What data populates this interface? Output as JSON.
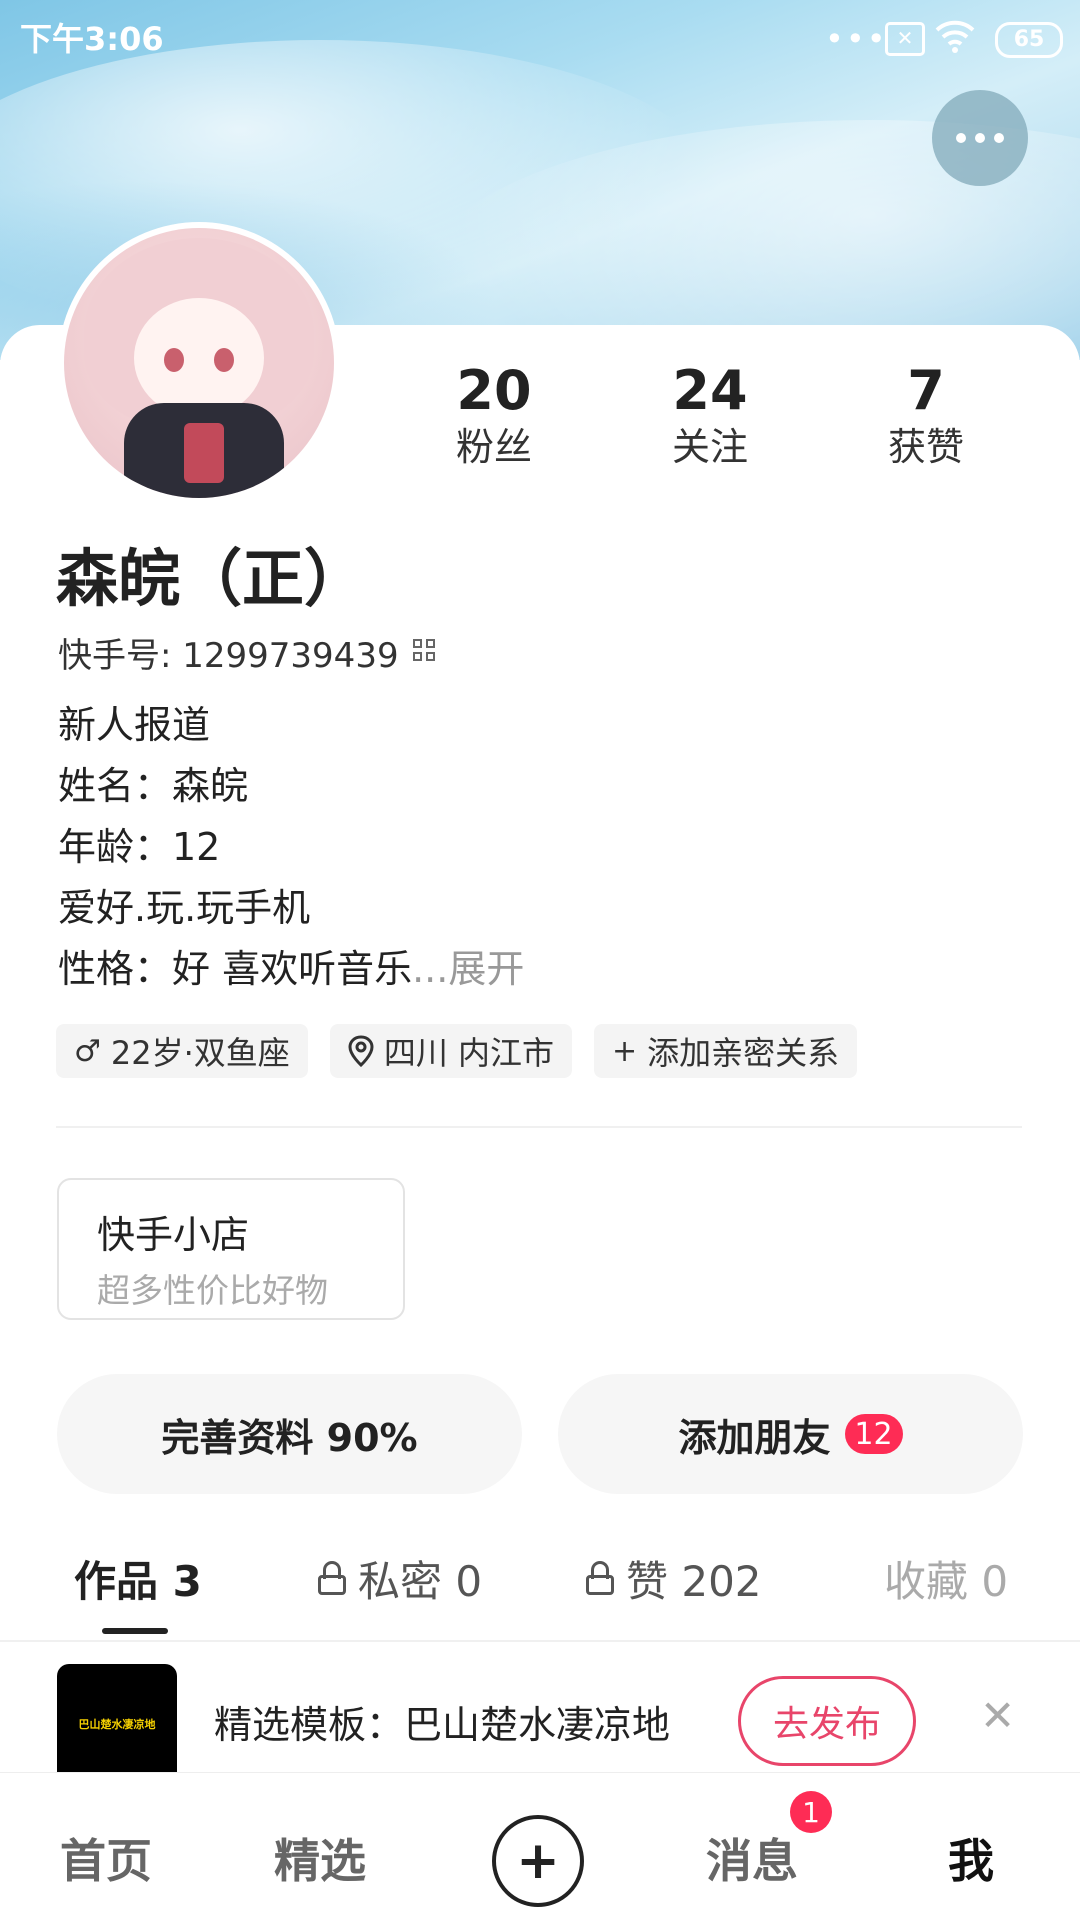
{
  "status_bar": {
    "time": "下午3:06",
    "battery": "65"
  },
  "profile": {
    "stats": [
      {
        "num": "20",
        "label": "粉丝"
      },
      {
        "num": "24",
        "label": "关注"
      },
      {
        "num": "7",
        "label": "获赞"
      }
    ],
    "name": "森皖（正）",
    "kuaishou_id": "快手号: 1299739439",
    "bio": {
      "line1": "新人报道",
      "line2": "姓名：森皖",
      "line3": "年龄：12",
      "line4": "爱好.玩.玩手机",
      "line5": "性格：好 喜欢听音乐",
      "expand": "...展开"
    },
    "tags": {
      "age_sign": "22岁·双鱼座",
      "location": "四川 内江市",
      "relation": "添加亲密关系"
    }
  },
  "shop": {
    "title": "快手小店",
    "subtitle": "超多性价比好物"
  },
  "actions": {
    "complete_profile": "完善资料 90%",
    "add_friends": "添加朋友",
    "add_friends_count": "12"
  },
  "tabs": {
    "works": "作品 3",
    "private": "私密 0",
    "likes": "赞 202",
    "favorites": "收藏 0"
  },
  "banner": {
    "thumb_text": "巴山楚水凄凉地",
    "text": "精选模板：巴山楚水凄凉地",
    "publish_label": "去发布"
  },
  "nav": {
    "home": "首页",
    "featured": "精选",
    "messages": "消息",
    "messages_badge": "1",
    "me": "我"
  }
}
